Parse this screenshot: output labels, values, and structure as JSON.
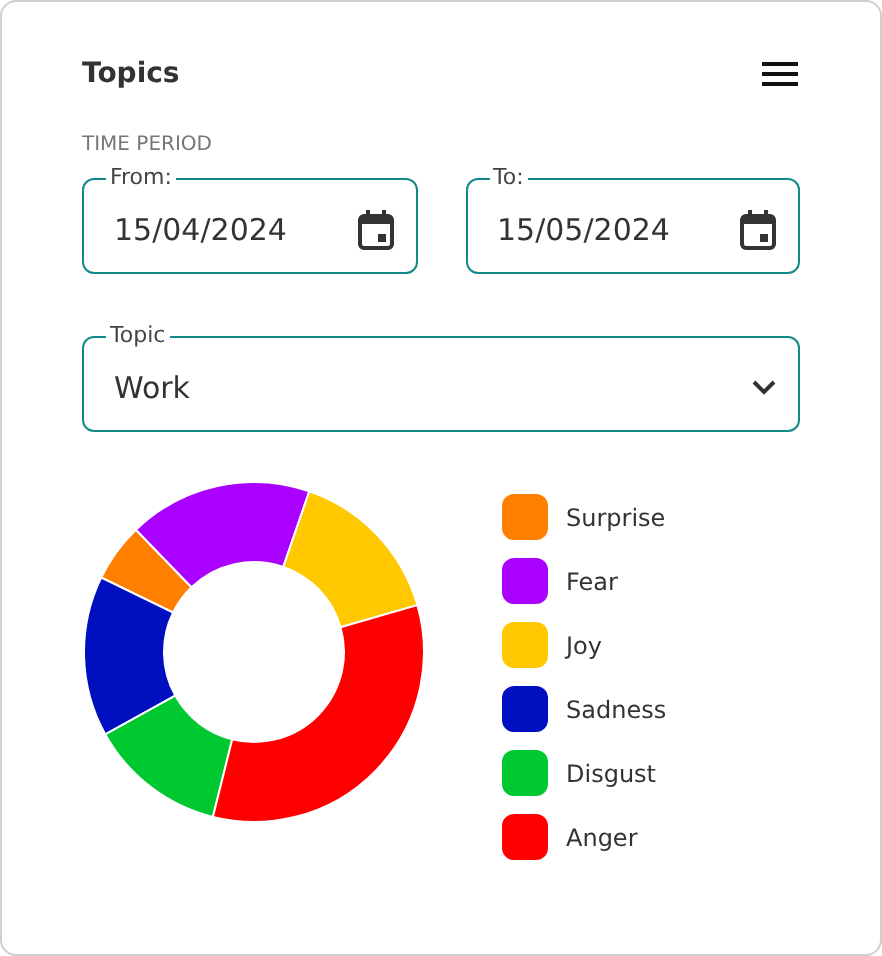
{
  "title": "Topics",
  "section_label": "TIME PERIOD",
  "date_fields": [
    {
      "label": "From:",
      "value": "15/04/2024"
    },
    {
      "label": "To:",
      "value": "15/05/2024"
    }
  ],
  "topic_select": {
    "label": "Topic",
    "value": "Work"
  },
  "legend": [
    {
      "label": "Surprise",
      "color": "#ff7f00"
    },
    {
      "label": "Fear",
      "color": "#aa00ff"
    },
    {
      "label": "Joy",
      "color": "#ffc800"
    },
    {
      "label": "Sadness",
      "color": "#0010c0"
    },
    {
      "label": "Disgust",
      "color": "#00c830"
    },
    {
      "label": "Anger",
      "color": "#ff0000"
    }
  ]
}
